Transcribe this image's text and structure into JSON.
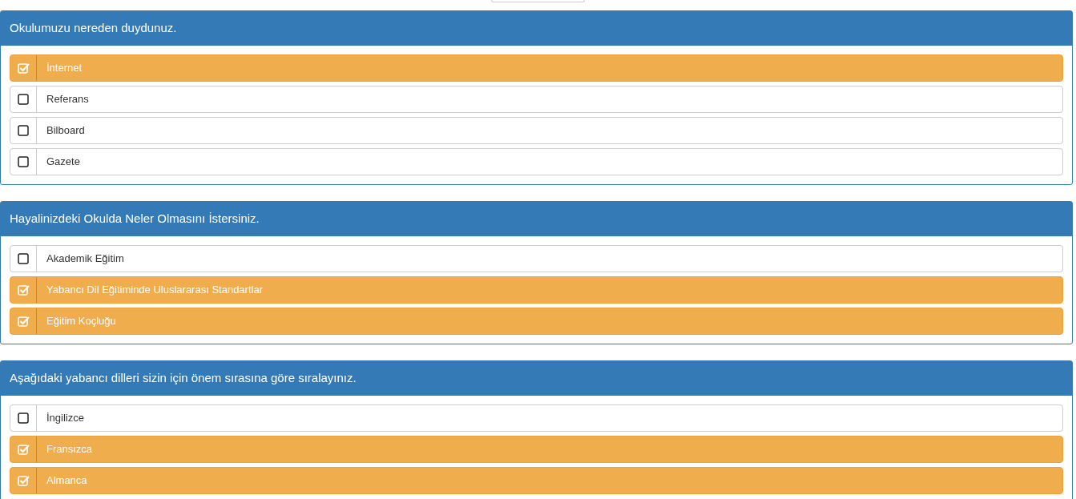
{
  "panels": [
    {
      "title": "Okulumuzu nereden duydunuz.",
      "options": [
        {
          "label": "İnternet",
          "checked": true
        },
        {
          "label": "Referans",
          "checked": false
        },
        {
          "label": "Bilboard",
          "checked": false
        },
        {
          "label": "Gazete",
          "checked": false
        }
      ]
    },
    {
      "title": "Hayalinizdeki Okulda Neler Olmasını İstersiniz.",
      "options": [
        {
          "label": "Akademik Eğitim",
          "checked": false
        },
        {
          "label": "Yabancı Dil Eğitiminde Uluslararası Standartlar",
          "checked": true
        },
        {
          "label": "Eğitim Koçluğu",
          "checked": true
        }
      ]
    },
    {
      "title": "Aşağıdaki yabancı dilleri sizin için önem sırasına göre sıralayınız.",
      "options": [
        {
          "label": "İngilizce",
          "checked": false
        },
        {
          "label": "Fransızca",
          "checked": true
        },
        {
          "label": "Almanca",
          "checked": true
        }
      ]
    }
  ]
}
